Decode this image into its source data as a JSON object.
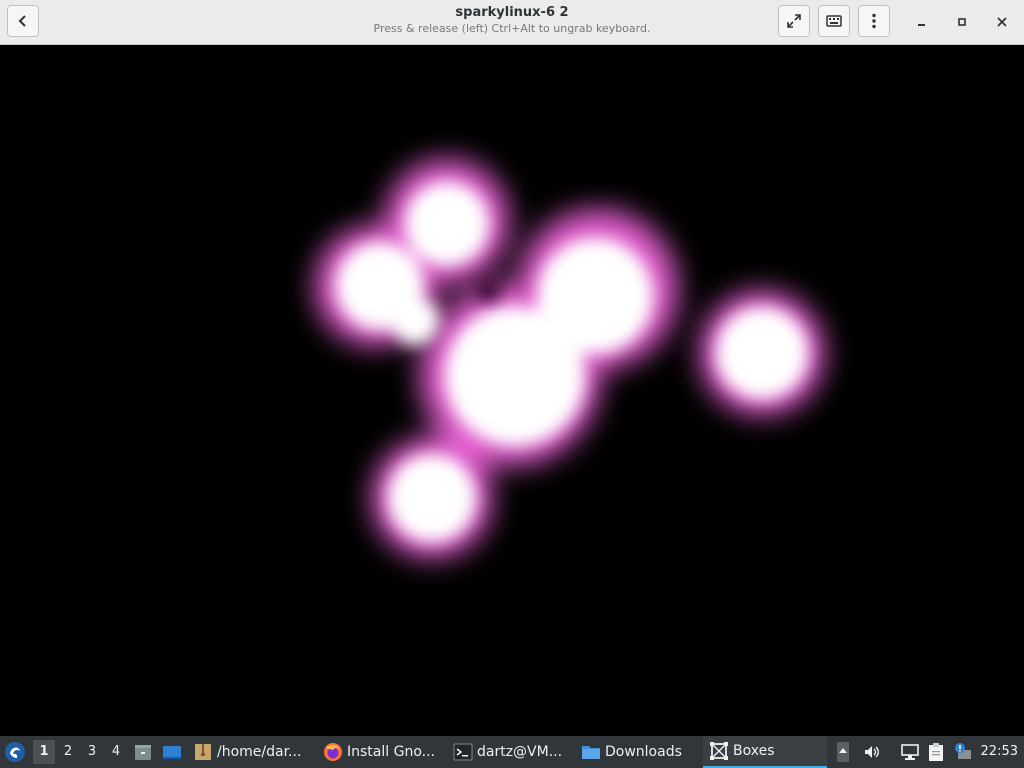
{
  "window": {
    "title": "sparkylinux-6 2",
    "subtitle": "Press & release (left) Ctrl+Alt to ungrab keyboard."
  },
  "icons": {
    "back": "back-arrow-icon",
    "fullscreen": "fullscreen-icon",
    "keyboard": "keyboard-icon",
    "menu": "kebab-menu-icon",
    "minimize": "minimize-icon",
    "maximize": "maximize-icon",
    "close": "close-icon"
  },
  "colors": {
    "glow": "#e35fcf",
    "taskbar": "#31363b",
    "accent": "#3daee9"
  },
  "taskbar": {
    "workspaces": [
      "1",
      "2",
      "3",
      "4"
    ],
    "active_workspace": "1",
    "tasks": [
      {
        "label": "/home/dar...",
        "icon": "archive-icon"
      },
      {
        "label": "Install Gno...",
        "icon": "firefox-icon"
      },
      {
        "label": "dartz@VM...",
        "icon": "terminal-icon"
      },
      {
        "label": "Downloads",
        "icon": "folder-icon"
      },
      {
        "label": "Boxes",
        "icon": "boxes-icon",
        "active": true
      }
    ],
    "clock": "22:53"
  }
}
